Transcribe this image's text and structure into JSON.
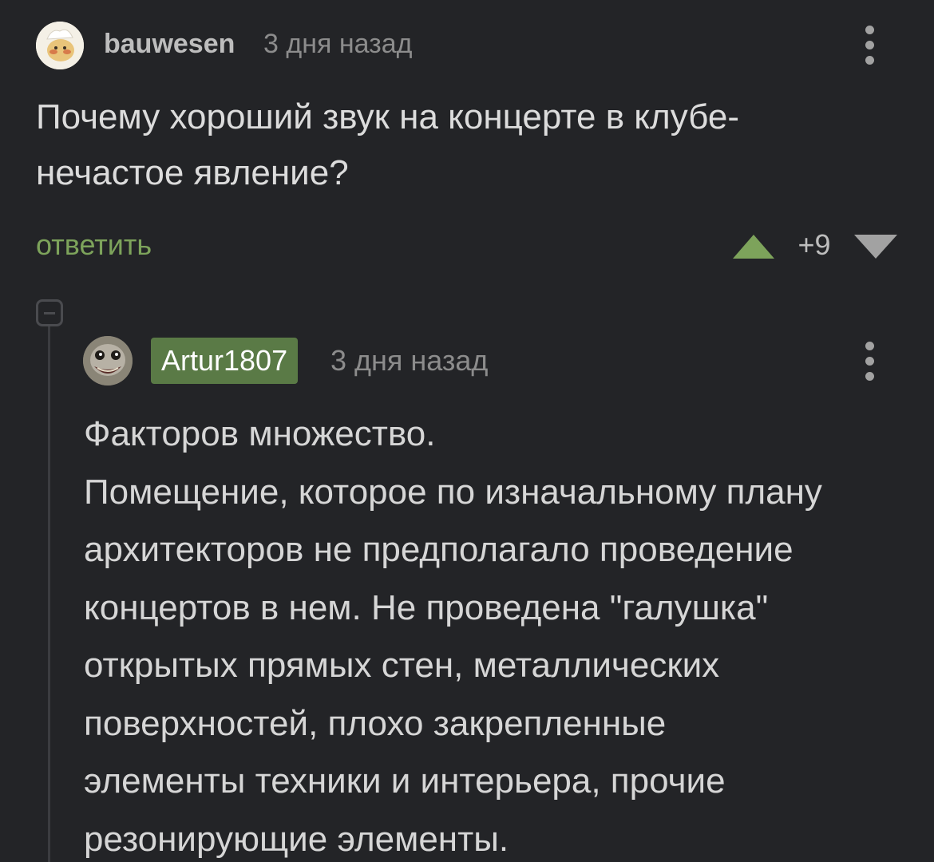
{
  "top_comment": {
    "username": "bauwesen",
    "time": "3 дня назад",
    "avatar_icon": "cartoon-avatar-icon",
    "text": "Почему хороший звук на концерте в клубе-\nнечастое явление?",
    "reply_label": "ответить",
    "score": "+9"
  },
  "reply_comment": {
    "username": "Artur1807",
    "time": "3 дня назад",
    "avatar_icon": "ostrich-avatar-icon",
    "text": "Факторов множество.\nПомещение, которое по изначальному плану\nархитекторов не предполагало проведение\nконцертов в нем. Не проведена \"галушка\"\nоткрытых прямых стен, металлических\nповерхностей, плохо закрепленные\nэлементы техники и интерьера, прочие\nрезонирующие элементы."
  },
  "colors": {
    "background": "#232427",
    "accent_green": "#7da35b",
    "username_badge": "#5a7a46",
    "downvote": "#a2a2a2"
  }
}
